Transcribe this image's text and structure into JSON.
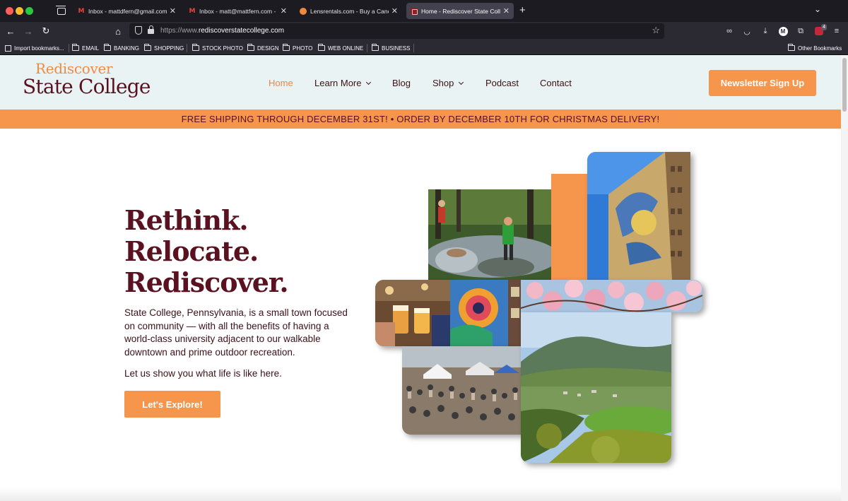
{
  "browser": {
    "tabs": [
      {
        "title": "Inbox - mattdfern@gmail.com -",
        "favicon": "gmail-icon",
        "active": false
      },
      {
        "title": "Inbox - matt@mattfern.com - Fe",
        "favicon": "gmail-icon",
        "active": false
      },
      {
        "title": "Lensrentals.com - Buy a Canon",
        "favicon": "lensrentals-icon",
        "active": false
      },
      {
        "title": "Home - Rediscover State Colleg",
        "favicon": "rediscover-icon",
        "active": true
      }
    ],
    "url_prefix": "https://www.",
    "url_domain": "rediscoverstatecollege.com",
    "extension_badge": "4",
    "bookmarks": [
      "Import bookmarks...",
      "EMAIL",
      "BANKING",
      "SHOPPING",
      "STOCK PHOTO",
      "DESIGN",
      "PHOTO",
      "WEB ONLINE",
      "BUSINESS"
    ],
    "other_bookmarks": "Other Bookmarks"
  },
  "site": {
    "logo_top": "Rediscover",
    "logo_bottom": "State College",
    "nav": [
      {
        "label": "Home",
        "active": true,
        "dropdown": false
      },
      {
        "label": "Learn More",
        "active": false,
        "dropdown": true
      },
      {
        "label": "Blog",
        "active": false,
        "dropdown": false
      },
      {
        "label": "Shop",
        "active": false,
        "dropdown": true
      },
      {
        "label": "Podcast",
        "active": false,
        "dropdown": false
      },
      {
        "label": "Contact",
        "active": false,
        "dropdown": false
      }
    ],
    "newsletter_label": "Newsletter Sign Up",
    "promo": "FREE SHIPPING THROUGH DECEMBER 31ST!  •  ORDER BY DECEMBER 10TH FOR CHRISTMAS DELIVERY!",
    "hero": {
      "title_lines": [
        "Rethink.",
        "Relocate.",
        "Rediscover."
      ],
      "description": "State College, Pennsylvania, is a small town focused on community — with all the benefits of having a world-class university adjacent to our walkable downtown and prime outdoor recreation.",
      "sub": "Let us show you what life is like here.",
      "button": "Let's Explore!"
    },
    "colors": {
      "accent": "#f6954c",
      "brand": "#5a1220",
      "header_bg": "#e9f3f3"
    }
  }
}
